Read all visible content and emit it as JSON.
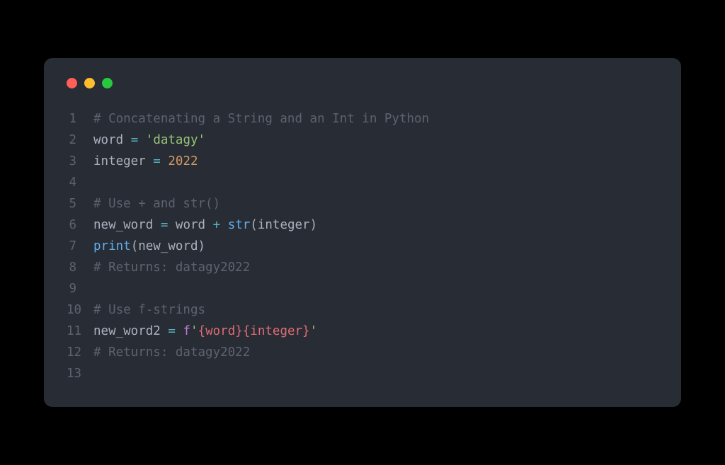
{
  "window": {
    "traffic_lights": [
      "red",
      "yellow",
      "green"
    ]
  },
  "code": {
    "lines": [
      {
        "num": "1",
        "tokens": [
          {
            "cls": "comment",
            "text": "# Concatenating a String and an Int in Python"
          }
        ]
      },
      {
        "num": "2",
        "tokens": [
          {
            "cls": "identifier",
            "text": "word "
          },
          {
            "cls": "operator",
            "text": "="
          },
          {
            "cls": "plain",
            "text": " "
          },
          {
            "cls": "string",
            "text": "'datagy'"
          }
        ]
      },
      {
        "num": "3",
        "tokens": [
          {
            "cls": "identifier",
            "text": "integer "
          },
          {
            "cls": "operator",
            "text": "="
          },
          {
            "cls": "plain",
            "text": " "
          },
          {
            "cls": "number",
            "text": "2022"
          }
        ]
      },
      {
        "num": "4",
        "tokens": []
      },
      {
        "num": "5",
        "tokens": [
          {
            "cls": "comment",
            "text": "# Use + and str()"
          }
        ]
      },
      {
        "num": "6",
        "tokens": [
          {
            "cls": "identifier",
            "text": "new_word "
          },
          {
            "cls": "operator",
            "text": "="
          },
          {
            "cls": "plain",
            "text": " word "
          },
          {
            "cls": "operator",
            "text": "+"
          },
          {
            "cls": "plain",
            "text": " "
          },
          {
            "cls": "function",
            "text": "str"
          },
          {
            "cls": "paren",
            "text": "("
          },
          {
            "cls": "plain",
            "text": "integer"
          },
          {
            "cls": "paren",
            "text": ")"
          }
        ]
      },
      {
        "num": "7",
        "tokens": [
          {
            "cls": "function",
            "text": "print"
          },
          {
            "cls": "paren",
            "text": "("
          },
          {
            "cls": "plain",
            "text": "new_word"
          },
          {
            "cls": "paren",
            "text": ")"
          }
        ]
      },
      {
        "num": "8",
        "tokens": [
          {
            "cls": "comment",
            "text": "# Returns: datagy2022"
          }
        ]
      },
      {
        "num": "9",
        "tokens": []
      },
      {
        "num": "10",
        "tokens": [
          {
            "cls": "comment",
            "text": "# Use f-strings"
          }
        ]
      },
      {
        "num": "11",
        "tokens": [
          {
            "cls": "identifier",
            "text": "new_word2 "
          },
          {
            "cls": "operator",
            "text": "="
          },
          {
            "cls": "plain",
            "text": " "
          },
          {
            "cls": "keyword-letter",
            "text": "f"
          },
          {
            "cls": "string",
            "text": "'"
          },
          {
            "cls": "template-arg",
            "text": "{word}{integer}"
          },
          {
            "cls": "string",
            "text": "'"
          }
        ]
      },
      {
        "num": "12",
        "tokens": [
          {
            "cls": "comment",
            "text": "# Returns: datagy2022"
          }
        ]
      },
      {
        "num": "13",
        "tokens": []
      }
    ]
  }
}
